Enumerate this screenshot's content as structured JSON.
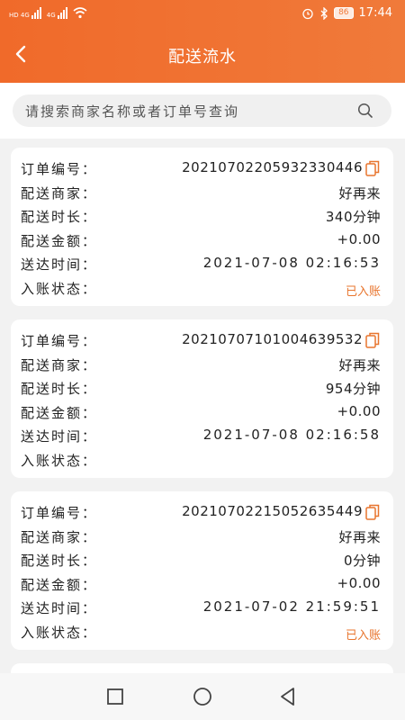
{
  "statusbar": {
    "network_tags": [
      "HD 4G",
      "4G"
    ],
    "battery": "86",
    "time": "17:44"
  },
  "header": {
    "title": "配送流水"
  },
  "search": {
    "placeholder": "请搜索商家名称或者订单号查询"
  },
  "labels": {
    "order_no": "订单编号：",
    "merchant": "配送商家：",
    "duration": "配送时长：",
    "amount": "配送金额：",
    "delivered_time": "送达时间：",
    "account_status": "入账状态："
  },
  "orders": [
    {
      "order_no": "20210702205932330446",
      "merchant": "好再来",
      "duration": "340分钟",
      "amount": "+0.00",
      "delivered_time": "2021-07-08 02:16:53",
      "account_status": "已入账"
    },
    {
      "order_no": "20210707101004639532",
      "merchant": "好再来",
      "duration": "954分钟",
      "amount": "+0.00",
      "delivered_time": "2021-07-08 02:16:58",
      "account_status": ""
    },
    {
      "order_no": "20210702215052635449",
      "merchant": "好再来",
      "duration": "0分钟",
      "amount": "+0.00",
      "delivered_time": "2021-07-02 21:59:51",
      "account_status": "已入账"
    }
  ],
  "colors": {
    "header": "#f06a2a",
    "accent": "#e8752e",
    "background": "#f2f2f2"
  },
  "navbar": {
    "icons": [
      "square-icon",
      "circle-icon",
      "back-triangle-icon"
    ]
  }
}
